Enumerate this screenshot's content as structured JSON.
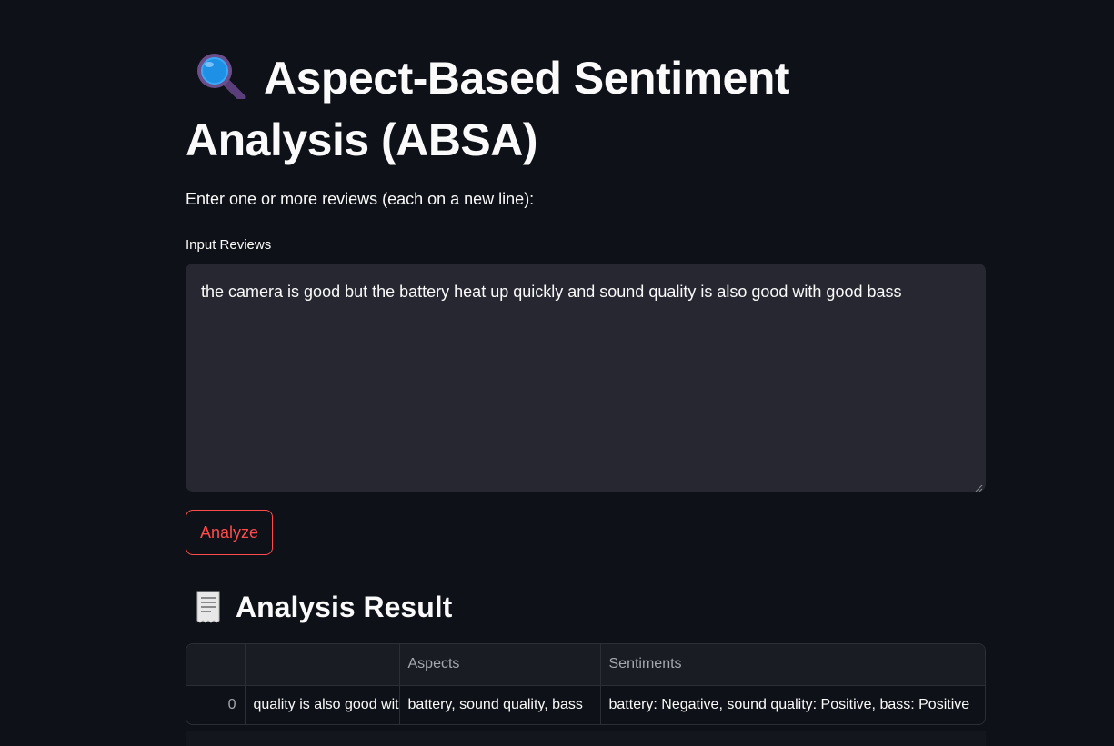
{
  "header": {
    "title": "Aspect-Based Sentiment Analysis (ABSA)",
    "title_icon": "magnifying-glass-icon"
  },
  "form": {
    "instructions": "Enter one or more reviews (each on a new line):",
    "input_label": "Input Reviews",
    "input_value": "the camera is good but the battery heat up quickly and sound quality is also good with good bass",
    "analyze_label": "Analyze"
  },
  "results": {
    "heading": "Analysis Result",
    "heading_icon": "receipt-icon",
    "columns": [
      "",
      "",
      "Aspects",
      "Sentiments"
    ],
    "rows": [
      {
        "index": "0",
        "review": "quality is also good wit",
        "aspects": "battery, sound quality, bass",
        "sentiments": "battery: Negative, sound quality: Positive, bass: Positive"
      }
    ]
  },
  "colors": {
    "background": "#0e1117",
    "input_background": "#262730",
    "accent": "#ff4b4b",
    "text": "#fafafa"
  }
}
